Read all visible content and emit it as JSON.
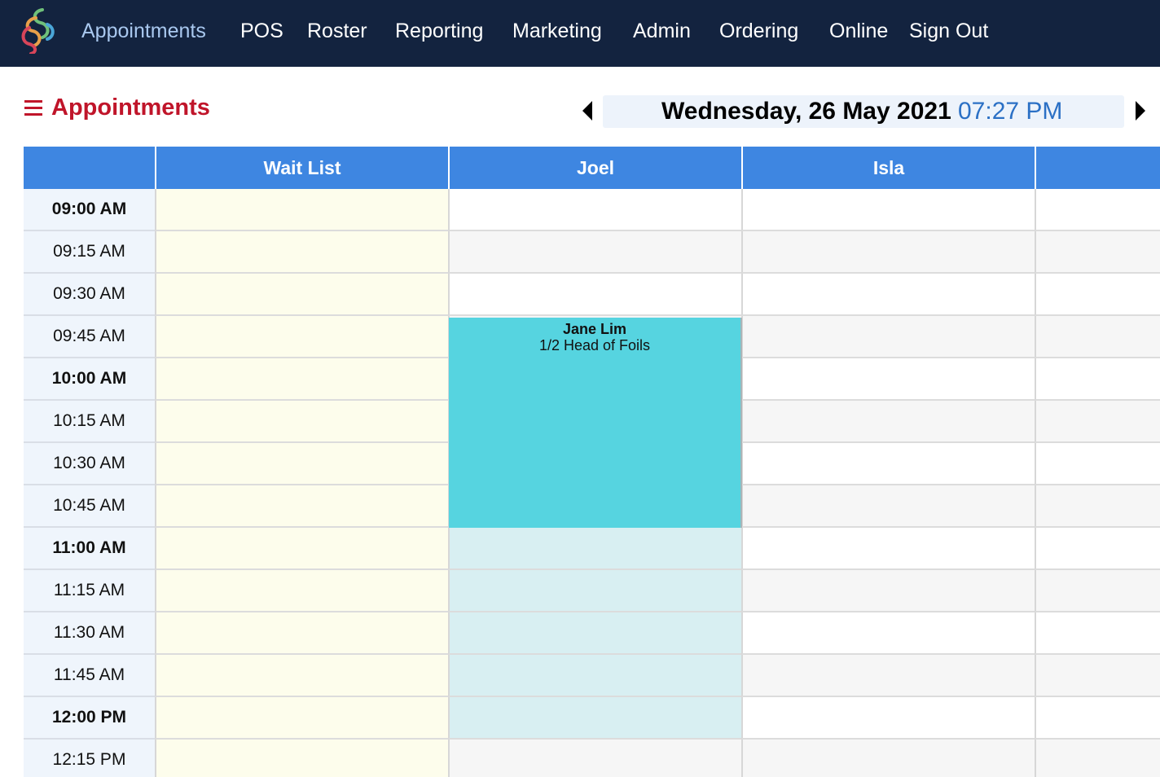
{
  "nav": {
    "items": [
      {
        "label": "Appointments",
        "active": true
      },
      {
        "label": "POS"
      },
      {
        "label": "Roster"
      },
      {
        "label": "Reporting"
      },
      {
        "label": "Marketing"
      },
      {
        "label": "Admin"
      },
      {
        "label": "Ordering"
      },
      {
        "label": "Online"
      },
      {
        "label": "Sign Out"
      }
    ]
  },
  "header": {
    "title": "Appointments",
    "date": "Wednesday, 26 May 2021",
    "time": "07:27 PM"
  },
  "columns": [
    "Wait List",
    "Joel",
    "Isla",
    ""
  ],
  "times": [
    "09:00 AM",
    "09:15 AM",
    "09:30 AM",
    "09:45 AM",
    "10:00 AM",
    "10:15 AM",
    "10:30 AM",
    "10:45 AM",
    "11:00 AM",
    "11:15 AM",
    "11:30 AM",
    "11:45 AM",
    "12:00 PM",
    "12:15 PM"
  ],
  "appointment": {
    "client": "Jane Lim",
    "service": "1/2 Head of Foils",
    "staff": "Joel",
    "start": "09:45 AM",
    "end": "11:00 AM"
  },
  "colors": {
    "nav_bg": "#13233f",
    "accent_red": "#c0152a",
    "header_blue": "#3e86e1",
    "appointment": "#56d4e0",
    "wait_list": "#fdfdec",
    "time_blue": "#2b70c5"
  }
}
